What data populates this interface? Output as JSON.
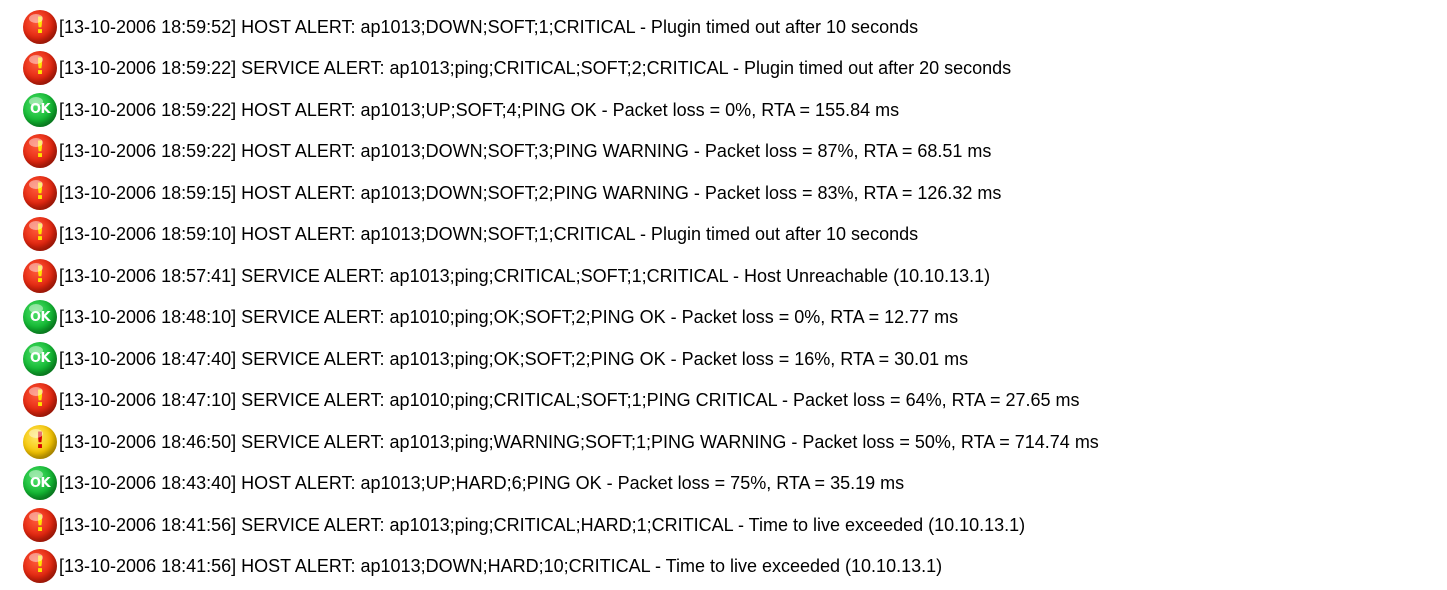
{
  "log": {
    "entries": [
      {
        "icon": "critical-icon",
        "glyph": "!",
        "text": "[13-10-2006 18:59:52] HOST ALERT: ap1013;DOWN;SOFT;1;CRITICAL - Plugin timed out after 10 seconds"
      },
      {
        "icon": "critical-icon",
        "glyph": "!",
        "text": "[13-10-2006 18:59:22] SERVICE ALERT: ap1013;ping;CRITICAL;SOFT;2;CRITICAL - Plugin timed out after 20 seconds"
      },
      {
        "icon": "ok-icon",
        "glyph": "OK",
        "text": "[13-10-2006 18:59:22] HOST ALERT: ap1013;UP;SOFT;4;PING OK - Packet loss = 0%, RTA = 155.84 ms"
      },
      {
        "icon": "critical-icon",
        "glyph": "!",
        "text": "[13-10-2006 18:59:22] HOST ALERT: ap1013;DOWN;SOFT;3;PING WARNING - Packet loss = 87%, RTA = 68.51 ms"
      },
      {
        "icon": "critical-icon",
        "glyph": "!",
        "text": "[13-10-2006 18:59:15] HOST ALERT: ap1013;DOWN;SOFT;2;PING WARNING - Packet loss = 83%, RTA = 126.32 ms"
      },
      {
        "icon": "critical-icon",
        "glyph": "!",
        "text": "[13-10-2006 18:59:10] HOST ALERT: ap1013;DOWN;SOFT;1;CRITICAL - Plugin timed out after 10 seconds"
      },
      {
        "icon": "critical-icon",
        "glyph": "!",
        "text": "[13-10-2006 18:57:41] SERVICE ALERT: ap1013;ping;CRITICAL;SOFT;1;CRITICAL - Host Unreachable (10.10.13.1)"
      },
      {
        "icon": "ok-icon",
        "glyph": "OK",
        "text": "[13-10-2006 18:48:10] SERVICE ALERT: ap1010;ping;OK;SOFT;2;PING OK - Packet loss = 0%, RTA = 12.77 ms"
      },
      {
        "icon": "ok-icon",
        "glyph": "OK",
        "text": "[13-10-2006 18:47:40] SERVICE ALERT: ap1013;ping;OK;SOFT;2;PING OK - Packet loss = 16%, RTA = 30.01 ms"
      },
      {
        "icon": "critical-icon",
        "glyph": "!",
        "text": "[13-10-2006 18:47:10] SERVICE ALERT: ap1010;ping;CRITICAL;SOFT;1;PING CRITICAL - Packet loss = 64%, RTA = 27.65 ms"
      },
      {
        "icon": "warning-icon",
        "glyph": "!",
        "text": "[13-10-2006 18:46:50] SERVICE ALERT: ap1013;ping;WARNING;SOFT;1;PING WARNING - Packet loss = 50%, RTA = 714.74 ms"
      },
      {
        "icon": "ok-icon",
        "glyph": "OK",
        "text": "[13-10-2006 18:43:40] HOST ALERT: ap1013;UP;HARD;6;PING OK - Packet loss = 75%, RTA = 35.19 ms"
      },
      {
        "icon": "critical-icon",
        "glyph": "!",
        "text": "[13-10-2006 18:41:56] SERVICE ALERT: ap1013;ping;CRITICAL;HARD;1;CRITICAL - Time to live exceeded (10.10.13.1)"
      },
      {
        "icon": "critical-icon",
        "glyph": "!",
        "text": "[13-10-2006 18:41:56] HOST ALERT: ap1013;DOWN;HARD;10;CRITICAL - Time to live exceeded (10.10.13.1)"
      }
    ]
  },
  "colors": {
    "critical": "#e3260f",
    "warning": "#f5c400",
    "ok": "#12b832",
    "text": "#000000",
    "background": "#ffffff"
  }
}
